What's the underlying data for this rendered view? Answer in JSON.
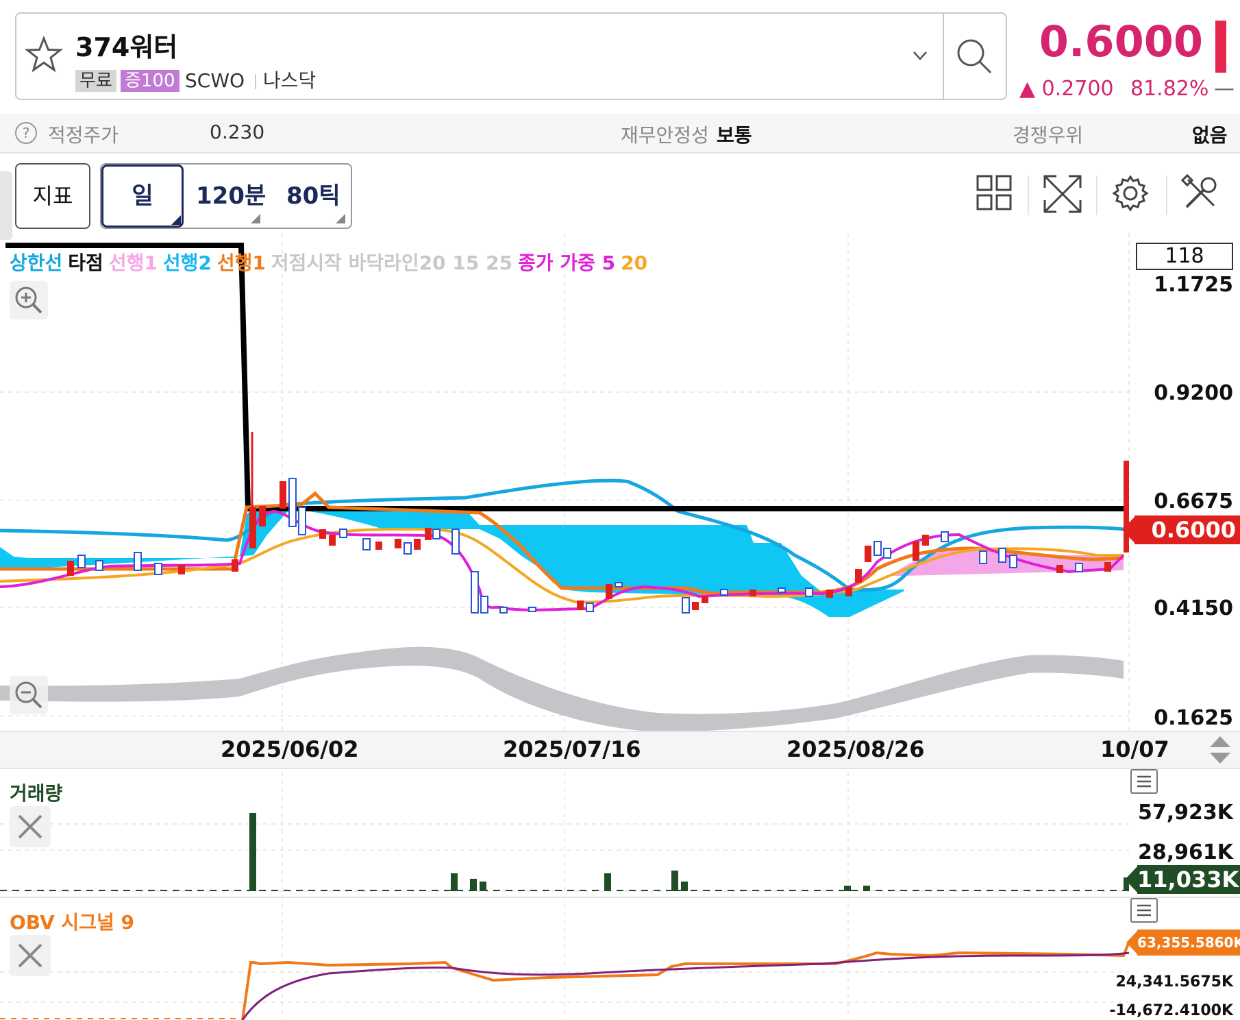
{
  "header": {
    "stock_name": "374워터",
    "tag_free": "무료",
    "tag_margin": "증100",
    "ticker": "SCWO",
    "market": "나스닥",
    "price": "0.6000",
    "change": "0.2700",
    "change_pct": "81.82%",
    "change_dash": "—",
    "accent_color": "#d6246e"
  },
  "info_bar": {
    "fair_price_label": "적정주가",
    "fair_price_value": "0.230",
    "stability_label": "재무안정성",
    "stability_value": "보통",
    "competitive_label": "경쟁우위",
    "competitive_value": "없음"
  },
  "toolbar": {
    "indicator_label": "지표",
    "period_day": "일",
    "period_120": "120분",
    "period_80tick": "80틱",
    "icons": [
      "grid-icon",
      "expand-icon",
      "settings-icon",
      "tools-icon"
    ]
  },
  "chart": {
    "legend": [
      {
        "text": "상한선",
        "color": "#16a6e0"
      },
      {
        "text": "타점",
        "color": "#111111"
      },
      {
        "text": "선행1",
        "color": "#f6a6e6"
      },
      {
        "text": "선행2",
        "color": "#16b6f0"
      },
      {
        "text": "선행1",
        "color": "#f07a1a"
      },
      {
        "text": "저점시작 바닥라인20 15 25",
        "color": "#c8c8c8"
      },
      {
        "text": "종가 가중 5",
        "color": "#e020d8"
      },
      {
        "text": "20",
        "color": "#f5a623"
      }
    ],
    "count": "118",
    "y_labels": [
      "1.1725",
      "0.9200",
      "0.6675",
      "0.4150",
      "0.1625"
    ],
    "current_price_tag": "0.6000",
    "dates": [
      "2025/06/02",
      "2025/07/16",
      "2025/08/26",
      "10/07"
    ]
  },
  "volume": {
    "title": "거래량",
    "labels": [
      "57,923K",
      "28,961K"
    ],
    "current_tag": "11,033K"
  },
  "obv": {
    "title": "OBV 시그널 9",
    "labels": [
      "24,341.5675K",
      "-14,672.4100K"
    ],
    "current_tag": "63,355.5860K"
  }
}
